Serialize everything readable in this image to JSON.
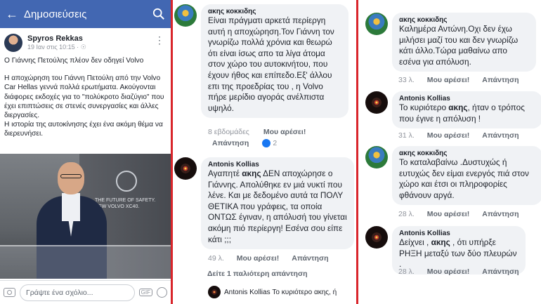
{
  "header": {
    "title": "Δημοσιεύσεις"
  },
  "post": {
    "author": "Spyros Rekkas",
    "time": "19 Ιαν στις 10:15 · ",
    "headline": "Ο Γιάννης Πετούλης πλέον δεν οδηγεί Volvo",
    "body1": "Η αποχώρηση του Γιάννη Πετούλη από την Volvo Car Hellas γεννά πολλά ερωτήματα. Ακούγονται διάφορες εκδοχές για το \"πολύκροτο διαζύγιο\" που έχει επιπτώσεις σε στενές συνεργασίες και άλλες διεργασίες.",
    "body2": "Η ιστορία της αυτοκίνησης έχει ένα ακόμη θέμα να διερευνήσει.",
    "photo_slogan": "THE FUTURE OF SAFETY. NEW VOLVO XC40."
  },
  "composer": {
    "placeholder": "Γράψτε ένα σχόλιο...",
    "gif": "GIF"
  },
  "labels": {
    "like": "Μου αρέσει!",
    "reply": "Απάντηση"
  },
  "comments": [
    {
      "author": "ακης κοκκιδης",
      "text": "Είναι πράγματι αρκετά περίεργη αυτή η αποχώρηση.Τον Γιάννη τον γνωρίζω πολλά χρόνια και θεωρώ ότι είναι ίσως απο τα λίγα άτομα στον χώρο του αυτοκινήτου, που έχουν ήθος και επίπεδο.Εξ' άλλου επι της προεδρίας του , η Volvo πήρε μερίδιο αγοράς ανέλπιστα υψηλό.",
      "age": "8 εβδομάδες",
      "reactions": "2"
    },
    {
      "author": "Antonis Kollias",
      "text_pre": "Αγαπητέ ",
      "bold": "ακης",
      "text_post": " ΔΕΝ αποχώρησε ο Γιάννης. Απολύθηκε εν μιά νυκτί που λένε. Και με δεδομένο αυτά τα ΠΟΛΥ ΘΕΤΙΚΑ που γράφεις, τα οποία ΟΝΤΩΣ έγιναν, η απόλυσή του γίνεται ακόμη πιό περίεργη! Εσένα σου είπε κάτι ;;;",
      "age": "49 λ."
    },
    {
      "older": "Δείτε 1 παλιότερη απάντηση",
      "preview": "Antonis Kollias Το κυριότερο ακης, ή"
    },
    {
      "author": "ακης κοκκιδης",
      "text": "Καλημέρα Αντώνη.Οχι δεν έχω μιλήσει μαζί του και δεν γνωρίζω κάτι άλλο.Τώρα μαθαίνω απο εσένα για απόλυση.",
      "age": "33 λ."
    },
    {
      "author": "Antonis Kollias",
      "text_pre": "Το κυριότερο ",
      "bold": "ακης",
      "text_post": ", ήταν ο τρόπος που έγινε η απόλυση !",
      "age": "31 λ."
    },
    {
      "author": "ακης κοκκιδης",
      "text": "Το καταλαβαίνω .Δυστυχώς ή ευτυχώς δεν είμαι ενεργός πιά στον χώρο και έτσι οι πληροφορίες φθάνουν αργά.",
      "age": "28 λ."
    },
    {
      "author": "Antonis Kollias",
      "text_pre": "Δείχνει , ",
      "bold": "ακης",
      "text_post": " , ότι υπήρξε ΡΗΞΗ μεταξύ των δύο πλευρών .",
      "age": "28 λ."
    }
  ]
}
